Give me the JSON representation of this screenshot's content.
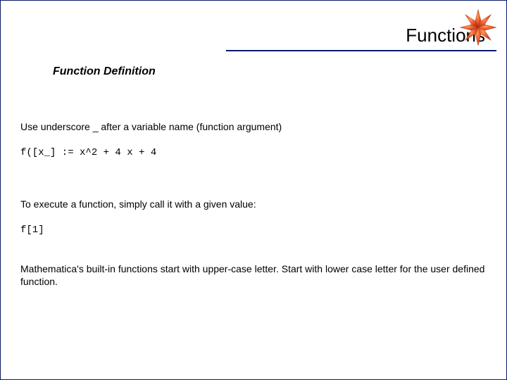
{
  "header": {
    "title": "Functions",
    "subtitle": "Function Definition"
  },
  "body": {
    "p1": "Use underscore _ after a variable name (function argument)",
    "code1": "f([x_] := x^2 + 4 x + 4",
    "p2": "To execute a function, simply call it with a given value:",
    "code2": "f[1]",
    "p3": "Mathematica's built-in functions start with upper-case letter. Start with lower case letter for the user defined function."
  },
  "logo": {
    "name": "mathematica-spikey-icon"
  }
}
